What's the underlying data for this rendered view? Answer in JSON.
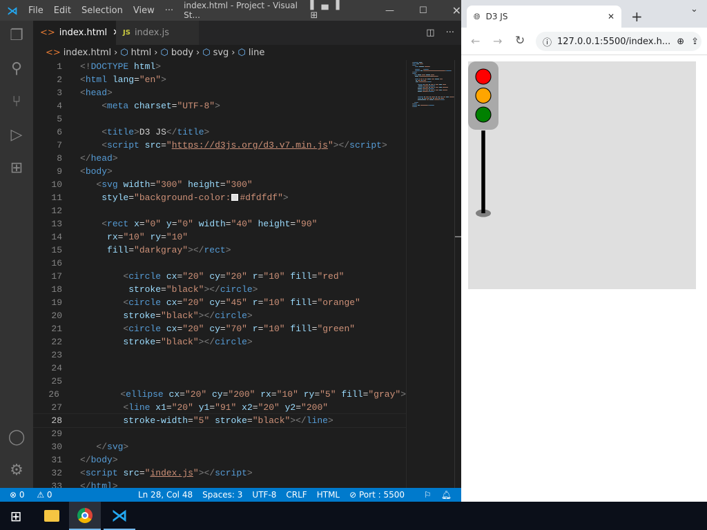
{
  "vscode": {
    "menu": [
      "File",
      "Edit",
      "Selection",
      "View",
      "···"
    ],
    "window_title": "index.html - Project - Visual St...",
    "tabs": [
      {
        "label": "index.html",
        "icon": "html-icon",
        "active": true
      },
      {
        "label": "index.js",
        "icon": "js-icon",
        "icon_text": "JS",
        "active": false
      }
    ],
    "breadcrumb": [
      "index.html",
      "html",
      "body",
      "svg",
      "line"
    ],
    "current_line": 28,
    "lines": [
      [
        [
          "p",
          "<!"
        ],
        [
          "t",
          "DOCTYPE"
        ],
        [
          "x",
          " "
        ],
        [
          "a",
          "html"
        ],
        [
          "p",
          ">"
        ]
      ],
      [
        [
          "p",
          "<"
        ],
        [
          "t",
          "html"
        ],
        [
          "x",
          " "
        ],
        [
          "a",
          "lang"
        ],
        [
          "x",
          "="
        ],
        [
          "s",
          "\"en\""
        ],
        [
          "p",
          ">"
        ]
      ],
      [
        [
          "p",
          "<"
        ],
        [
          "t",
          "head"
        ],
        [
          "p",
          ">"
        ]
      ],
      [
        [
          "x",
          "    "
        ],
        [
          "p",
          "<"
        ],
        [
          "t",
          "meta"
        ],
        [
          "x",
          " "
        ],
        [
          "a",
          "charset"
        ],
        [
          "x",
          "="
        ],
        [
          "s",
          "\"UTF-8\""
        ],
        [
          "p",
          ">"
        ]
      ],
      [],
      [
        [
          "x",
          "    "
        ],
        [
          "p",
          "<"
        ],
        [
          "t",
          "title"
        ],
        [
          "p",
          ">"
        ],
        [
          "x",
          "D3 JS"
        ],
        [
          "p",
          "</"
        ],
        [
          "t",
          "title"
        ],
        [
          "p",
          ">"
        ]
      ],
      [
        [
          "x",
          "    "
        ],
        [
          "p",
          "<"
        ],
        [
          "t",
          "script"
        ],
        [
          "x",
          " "
        ],
        [
          "a",
          "src"
        ],
        [
          "x",
          "="
        ],
        [
          "s",
          "\""
        ],
        [
          "u",
          "https://d3js.org/d3.v7.min.js"
        ],
        [
          "s",
          "\""
        ],
        [
          "p",
          "></"
        ],
        [
          "t",
          "script"
        ],
        [
          "p",
          ">"
        ]
      ],
      [
        [
          "p",
          "</"
        ],
        [
          "t",
          "head"
        ],
        [
          "p",
          ">"
        ]
      ],
      [
        [
          "p",
          "<"
        ],
        [
          "t",
          "body"
        ],
        [
          "p",
          ">"
        ]
      ],
      [
        [
          "x",
          "   "
        ],
        [
          "p",
          "<"
        ],
        [
          "t",
          "svg"
        ],
        [
          "x",
          " "
        ],
        [
          "a",
          "width"
        ],
        [
          "x",
          "="
        ],
        [
          "s",
          "\"300\""
        ],
        [
          "x",
          " "
        ],
        [
          "a",
          "height"
        ],
        [
          "x",
          "="
        ],
        [
          "s",
          "\"300\""
        ]
      ],
      [
        [
          "x",
          "    "
        ],
        [
          "a",
          "style"
        ],
        [
          "x",
          "="
        ],
        [
          "s",
          "\"background-color:"
        ],
        [
          "sw",
          ""
        ],
        [
          "s",
          "#dfdfdf\""
        ],
        [
          "p",
          ">"
        ]
      ],
      [],
      [
        [
          "x",
          "    "
        ],
        [
          "p",
          "<"
        ],
        [
          "t",
          "rect"
        ],
        [
          "x",
          " "
        ],
        [
          "a",
          "x"
        ],
        [
          "x",
          "="
        ],
        [
          "s",
          "\"0\""
        ],
        [
          "x",
          " "
        ],
        [
          "a",
          "y"
        ],
        [
          "x",
          "="
        ],
        [
          "s",
          "\"0\""
        ],
        [
          "x",
          " "
        ],
        [
          "a",
          "width"
        ],
        [
          "x",
          "="
        ],
        [
          "s",
          "\"40\""
        ],
        [
          "x",
          " "
        ],
        [
          "a",
          "height"
        ],
        [
          "x",
          "="
        ],
        [
          "s",
          "\"90\""
        ]
      ],
      [
        [
          "x",
          "     "
        ],
        [
          "a",
          "rx"
        ],
        [
          "x",
          "="
        ],
        [
          "s",
          "\"10\""
        ],
        [
          "x",
          " "
        ],
        [
          "a",
          "ry"
        ],
        [
          "x",
          "="
        ],
        [
          "s",
          "\"10\""
        ]
      ],
      [
        [
          "x",
          "     "
        ],
        [
          "a",
          "fill"
        ],
        [
          "x",
          "="
        ],
        [
          "s",
          "\"darkgray\""
        ],
        [
          "p",
          "></"
        ],
        [
          "t",
          "rect"
        ],
        [
          "p",
          ">"
        ]
      ],
      [],
      [
        [
          "x",
          "        "
        ],
        [
          "p",
          "<"
        ],
        [
          "t",
          "circle"
        ],
        [
          "x",
          " "
        ],
        [
          "a",
          "cx"
        ],
        [
          "x",
          "="
        ],
        [
          "s",
          "\"20\""
        ],
        [
          "x",
          " "
        ],
        [
          "a",
          "cy"
        ],
        [
          "x",
          "="
        ],
        [
          "s",
          "\"20\""
        ],
        [
          "x",
          " "
        ],
        [
          "a",
          "r"
        ],
        [
          "x",
          "="
        ],
        [
          "s",
          "\"10\""
        ],
        [
          "x",
          " "
        ],
        [
          "a",
          "fill"
        ],
        [
          "x",
          "="
        ],
        [
          "s",
          "\"red\""
        ]
      ],
      [
        [
          "x",
          "         "
        ],
        [
          "a",
          "stroke"
        ],
        [
          "x",
          "="
        ],
        [
          "s",
          "\"black\""
        ],
        [
          "p",
          "></"
        ],
        [
          "t",
          "circle"
        ],
        [
          "p",
          ">"
        ]
      ],
      [
        [
          "x",
          "        "
        ],
        [
          "p",
          "<"
        ],
        [
          "t",
          "circle"
        ],
        [
          "x",
          " "
        ],
        [
          "a",
          "cx"
        ],
        [
          "x",
          "="
        ],
        [
          "s",
          "\"20\""
        ],
        [
          "x",
          " "
        ],
        [
          "a",
          "cy"
        ],
        [
          "x",
          "="
        ],
        [
          "s",
          "\"45\""
        ],
        [
          "x",
          " "
        ],
        [
          "a",
          "r"
        ],
        [
          "x",
          "="
        ],
        [
          "s",
          "\"10\""
        ],
        [
          "x",
          " "
        ],
        [
          "a",
          "fill"
        ],
        [
          "x",
          "="
        ],
        [
          "s",
          "\"orange\""
        ]
      ],
      [
        [
          "x",
          "        "
        ],
        [
          "a",
          "stroke"
        ],
        [
          "x",
          "="
        ],
        [
          "s",
          "\"black\""
        ],
        [
          "p",
          "></"
        ],
        [
          "t",
          "circle"
        ],
        [
          "p",
          ">"
        ]
      ],
      [
        [
          "x",
          "        "
        ],
        [
          "p",
          "<"
        ],
        [
          "t",
          "circle"
        ],
        [
          "x",
          " "
        ],
        [
          "a",
          "cx"
        ],
        [
          "x",
          "="
        ],
        [
          "s",
          "\"20\""
        ],
        [
          "x",
          " "
        ],
        [
          "a",
          "cy"
        ],
        [
          "x",
          "="
        ],
        [
          "s",
          "\"70\""
        ],
        [
          "x",
          " "
        ],
        [
          "a",
          "r"
        ],
        [
          "x",
          "="
        ],
        [
          "s",
          "\"10\""
        ],
        [
          "x",
          " "
        ],
        [
          "a",
          "fill"
        ],
        [
          "x",
          "="
        ],
        [
          "s",
          "\"green\""
        ]
      ],
      [
        [
          "x",
          "        "
        ],
        [
          "a",
          "stroke"
        ],
        [
          "x",
          "="
        ],
        [
          "s",
          "\"black\""
        ],
        [
          "p",
          "></"
        ],
        [
          "t",
          "circle"
        ],
        [
          "p",
          ">"
        ]
      ],
      [],
      [],
      [],
      [
        [
          "x",
          "        "
        ],
        [
          "p",
          "<"
        ],
        [
          "t",
          "ellipse"
        ],
        [
          "x",
          " "
        ],
        [
          "a",
          "cx"
        ],
        [
          "x",
          "="
        ],
        [
          "s",
          "\"20\""
        ],
        [
          "x",
          " "
        ],
        [
          "a",
          "cy"
        ],
        [
          "x",
          "="
        ],
        [
          "s",
          "\"200\""
        ],
        [
          "x",
          " "
        ],
        [
          "a",
          "rx"
        ],
        [
          "x",
          "="
        ],
        [
          "s",
          "\"10\""
        ],
        [
          "x",
          " "
        ],
        [
          "a",
          "ry"
        ],
        [
          "x",
          "="
        ],
        [
          "s",
          "\"5\""
        ],
        [
          "x",
          " "
        ],
        [
          "a",
          "fill"
        ],
        [
          "x",
          "="
        ],
        [
          "s",
          "\"gray\""
        ],
        [
          "p",
          ">"
        ]
      ],
      [
        [
          "x",
          "        "
        ],
        [
          "p",
          "<"
        ],
        [
          "t",
          "line"
        ],
        [
          "x",
          " "
        ],
        [
          "a",
          "x1"
        ],
        [
          "x",
          "="
        ],
        [
          "s",
          "\"20\""
        ],
        [
          "x",
          " "
        ],
        [
          "a",
          "y1"
        ],
        [
          "x",
          "="
        ],
        [
          "s",
          "\"91\""
        ],
        [
          "x",
          " "
        ],
        [
          "a",
          "x2"
        ],
        [
          "x",
          "="
        ],
        [
          "s",
          "\"20\""
        ],
        [
          "x",
          " "
        ],
        [
          "a",
          "y2"
        ],
        [
          "x",
          "="
        ],
        [
          "s",
          "\"200\""
        ]
      ],
      [
        [
          "x",
          "        "
        ],
        [
          "a",
          "stroke-width"
        ],
        [
          "x",
          "="
        ],
        [
          "s",
          "\"5\""
        ],
        [
          "x",
          " "
        ],
        [
          "a",
          "stroke"
        ],
        [
          "x",
          "="
        ],
        [
          "s",
          "\"black\""
        ],
        [
          "p",
          "></"
        ],
        [
          "t",
          "line"
        ],
        [
          "p",
          ">"
        ]
      ],
      [],
      [
        [
          "x",
          "   "
        ],
        [
          "p",
          "</"
        ],
        [
          "t",
          "svg"
        ],
        [
          "p",
          ">"
        ]
      ],
      [
        [
          "p",
          "</"
        ],
        [
          "t",
          "body"
        ],
        [
          "p",
          ">"
        ]
      ],
      [
        [
          "p",
          "<"
        ],
        [
          "t",
          "script"
        ],
        [
          "x",
          " "
        ],
        [
          "a",
          "src"
        ],
        [
          "x",
          "="
        ],
        [
          "s",
          "\""
        ],
        [
          "u",
          "index.js"
        ],
        [
          "s",
          "\""
        ],
        [
          "p",
          "></"
        ],
        [
          "t",
          "script"
        ],
        [
          "p",
          ">"
        ]
      ],
      [
        [
          "p",
          "</"
        ],
        [
          "t",
          "html"
        ],
        [
          "p",
          ">"
        ]
      ]
    ],
    "status": {
      "errors": "0",
      "warnings": "0",
      "position": "Ln 28, Col 48",
      "spaces": "Spaces: 3",
      "encoding": "UTF-8",
      "eol": "CRLF",
      "language": "HTML",
      "port": "Port : 5500"
    },
    "colors": {
      "status_bar": "#007acc",
      "tag": "#569cd6",
      "attribute": "#9cdcfe",
      "string": "#ce9178"
    }
  },
  "browser": {
    "tab_title": "D3 JS",
    "url": "127.0.0.1:5500/index.h...",
    "svg": {
      "background": "#dfdfdf",
      "rect_fill": "darkgray",
      "lights": [
        "red",
        "orange",
        "green"
      ],
      "ellipse_fill": "gray",
      "pole": "black"
    }
  },
  "taskbar": {
    "items": [
      "windows-start",
      "file-explorer",
      "chrome",
      "vscode"
    ]
  }
}
